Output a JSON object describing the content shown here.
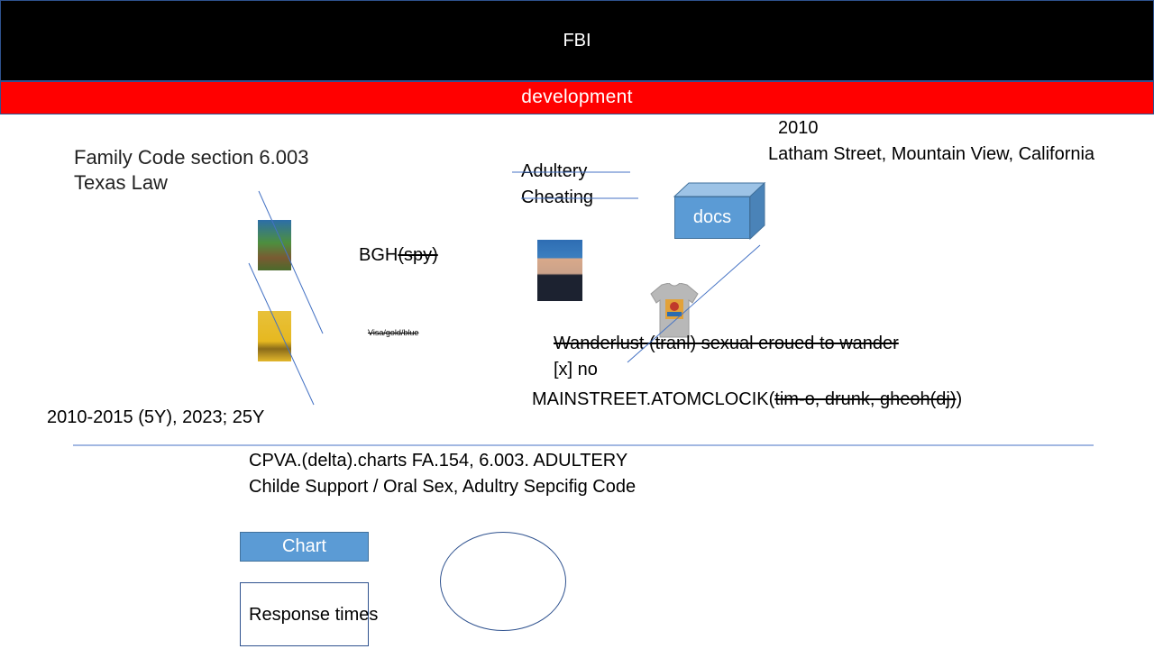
{
  "header": {
    "title": "FBI",
    "subtitle": "development"
  },
  "law": {
    "line1": "Family Code section 6.003",
    "line2": "Texas Law"
  },
  "location": {
    "year": "2010",
    "address": "Latham Street, Mountain View, California"
  },
  "terms": {
    "adultery": "Adultery",
    "cheating": "Cheating"
  },
  "docs_box": {
    "label": "docs"
  },
  "bgh": {
    "plain": "BGH",
    "struck": "(spy)"
  },
  "visa": {
    "label": "Visa/gold/blue"
  },
  "wanderlust": {
    "label": "Wanderlust (tranl) sexual eroued to wander"
  },
  "checkbox_line": {
    "label": "[x] no"
  },
  "mainstreet": {
    "plain": "MAINSTREET.ATOMCLOCIK(",
    "struck": "tim-o, drunk, gheoh(dj)",
    "closing": ")"
  },
  "years_range": {
    "label": "2010-2015 (5Y), 2023; 25Y"
  },
  "notes": {
    "line1": "CPVA.(delta).charts FA.154, 6.003. ADULTERY",
    "line2": "Childe Support / Oral Sex, Adultry Sepcifig Code"
  },
  "chart_button": {
    "label": "Chart"
  },
  "response_box": {
    "label": "Response times"
  },
  "colors": {
    "header_bg": "#000000",
    "subheader_bg": "#ff0000",
    "shape_fill": "#5b9bd5",
    "line_color": "#4472c4"
  }
}
